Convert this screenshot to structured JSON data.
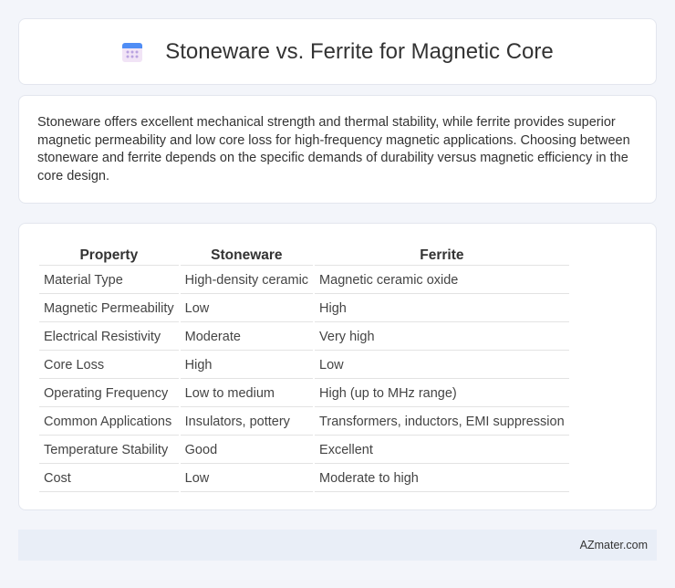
{
  "header": {
    "title": "Stoneware vs. Ferrite for Magnetic Core",
    "icon": "calendar-icon",
    "icon_colors": {
      "top": "#4f8df5",
      "body": "#f1e4f6",
      "dots": "#b9a3e0"
    }
  },
  "summary": {
    "text": "Stoneware offers excellent mechanical strength and thermal stability, while ferrite provides superior magnetic permeability and low core loss for high-frequency magnetic applications. Choosing between stoneware and ferrite depends on the specific demands of durability versus magnetic efficiency in the core design."
  },
  "table": {
    "headers": [
      "Property",
      "Stoneware",
      "Ferrite"
    ],
    "rows": [
      [
        "Material Type",
        "High-density ceramic",
        "Magnetic ceramic oxide"
      ],
      [
        "Magnetic Permeability",
        "Low",
        "High"
      ],
      [
        "Electrical Resistivity",
        "Moderate",
        "Very high"
      ],
      [
        "Core Loss",
        "High",
        "Low"
      ],
      [
        "Operating Frequency",
        "Low to medium",
        "High (up to MHz range)"
      ],
      [
        "Common Applications",
        "Insulators, pottery",
        "Transformers, inductors, EMI suppression"
      ],
      [
        "Temperature Stability",
        "Good",
        "Excellent"
      ],
      [
        "Cost",
        "Low",
        "Moderate to high"
      ]
    ]
  },
  "footer": {
    "site": "AZmater.com"
  }
}
